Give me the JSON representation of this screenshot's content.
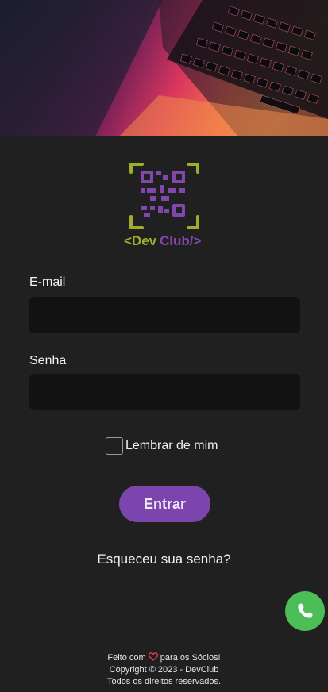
{
  "logo": {
    "prefix": "<Dev",
    "suffix": "Club/>",
    "icon": "qr-code-icon",
    "colors": {
      "lime": "#a0ad2c",
      "purple": "#8147ad"
    }
  },
  "form": {
    "email_label": "E-mail",
    "email_value": "",
    "password_label": "Senha",
    "password_value": "",
    "remember_label": "Lembrar de mim",
    "remember_checked": false,
    "submit_label": "Entrar",
    "forgot_label": "Esqueceu sua senha?"
  },
  "whatsapp": {
    "icon": "whatsapp-icon",
    "color": "#4cbd57"
  },
  "footer": {
    "made_with_prefix": "Feito com",
    "heart_icon": "heart-icon",
    "made_with_suffix": "para os Sócios!",
    "copyright": "Copyright © 2023 - DevClub",
    "rights": "Todos os direitos reservados."
  },
  "colors": {
    "accent": "#7c45ad",
    "background": "#202020",
    "input_bg": "#121212"
  }
}
